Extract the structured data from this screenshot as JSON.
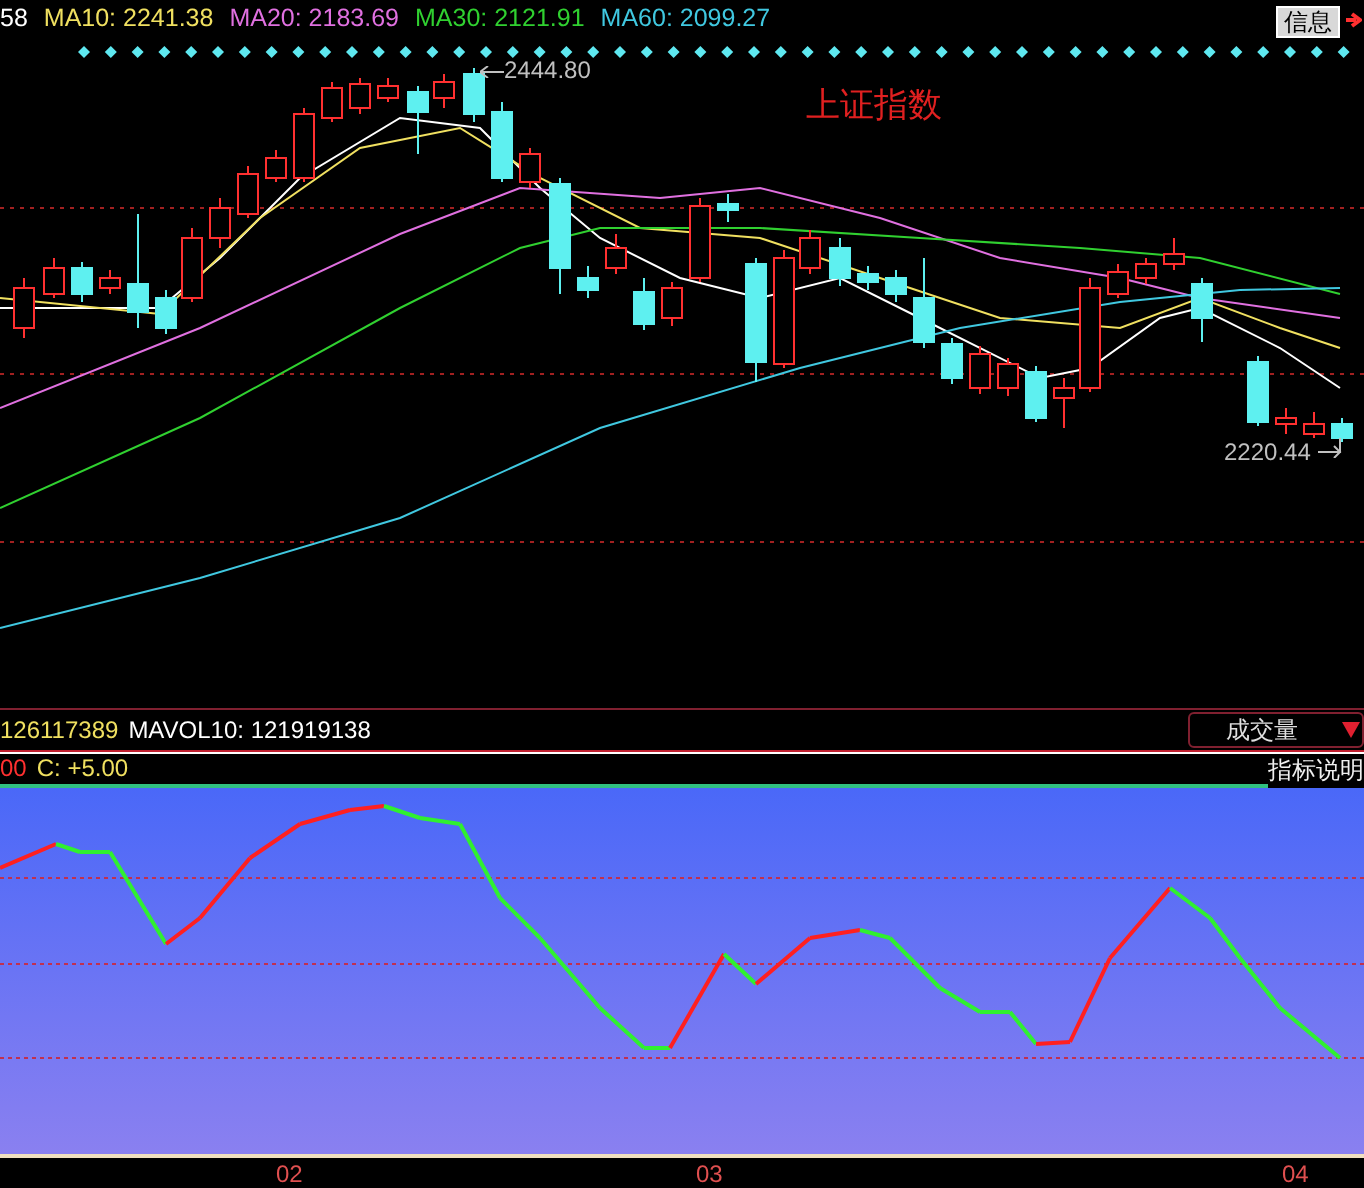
{
  "legend": [
    {
      "label": "58",
      "color": "#ffffff"
    },
    {
      "label": "MA10: 2241.38",
      "color": "#f0e060"
    },
    {
      "label": "MA20: 2183.69",
      "color": "#e070e0"
    },
    {
      "label": "MA30: 2121.91",
      "color": "#30d030"
    },
    {
      "label": "MA60: 2099.27",
      "color": "#40c8e0"
    }
  ],
  "info_button": "信息",
  "chart_title": "上证指数",
  "high_label": "2444.80",
  "low_label": "2220.44",
  "volume": {
    "values": [
      "126117389",
      "MAVOL10: 121919138"
    ],
    "selector": "成交量"
  },
  "indicator": {
    "values": [
      "00",
      "C: +5.00"
    ],
    "help": "指标说明"
  },
  "x_axis": [
    "02",
    "03",
    "04"
  ]
}
